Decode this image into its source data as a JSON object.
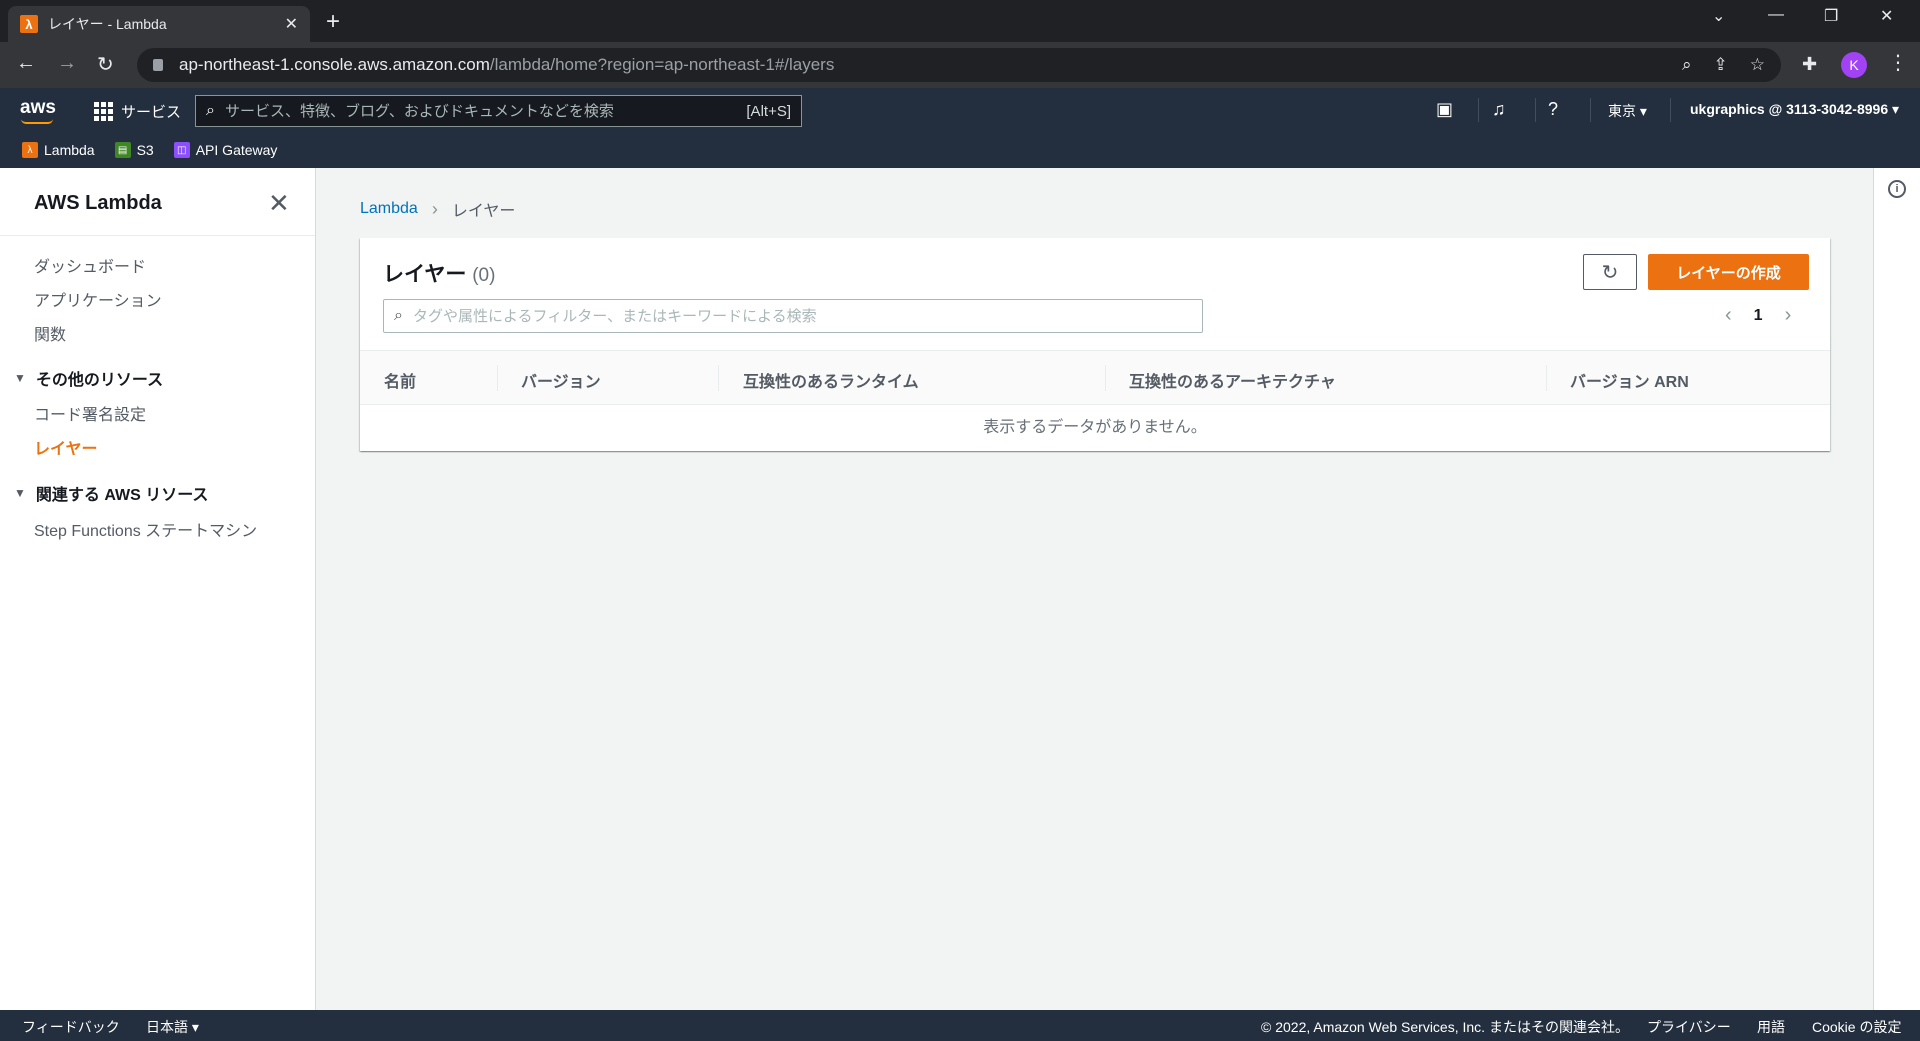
{
  "browser": {
    "tab_title": "レイヤー - Lambda",
    "url_host": "ap-northeast-1.console.aws.amazon.com",
    "url_path": "/lambda/home?region=ap-northeast-1#/layers",
    "profile_initial": "K"
  },
  "aws_nav": {
    "logo": "aws",
    "services_label": "サービス",
    "search_placeholder": "サービス、特徴、ブログ、およびドキュメントなどを検索",
    "search_shortcut": "[Alt+S]",
    "region": "東京 ▾",
    "account": "ukgraphics @ 3113-3042-8996 ▾"
  },
  "favorites": [
    {
      "label": "Lambda",
      "color": "#ec7211"
    },
    {
      "label": "S3",
      "color": "#3f8624"
    },
    {
      "label": "API Gateway",
      "color": "#8c4fff"
    }
  ],
  "sidebar": {
    "title": "AWS Lambda",
    "items": [
      "ダッシュボード",
      "アプリケーション",
      "関数"
    ],
    "section1": "その他のリソース",
    "section1_items": [
      "コード署名設定",
      "レイヤー"
    ],
    "section2": "関連する AWS リソース",
    "section2_items": [
      "Step Functions ステートマシン"
    ]
  },
  "breadcrumb": {
    "root": "Lambda",
    "current": "レイヤー"
  },
  "panel": {
    "title": "レイヤー",
    "count": "(0)",
    "create_button": "レイヤーの作成",
    "filter_placeholder": "タグや属性によるフィルター、またはキーワードによる検索",
    "page": "1",
    "columns": [
      "名前",
      "バージョン",
      "互換性のあるランタイム",
      "互換性のあるアーキテクチャ",
      "バージョン ARN"
    ],
    "empty_text": "表示するデータがありません。"
  },
  "footer": {
    "feedback": "フィードバック",
    "language": "日本語 ▾",
    "copyright": "© 2022, Amazon Web Services, Inc. またはその関連会社。",
    "privacy": "プライバシー",
    "terms": "用語",
    "cookie": "Cookie の設定"
  }
}
